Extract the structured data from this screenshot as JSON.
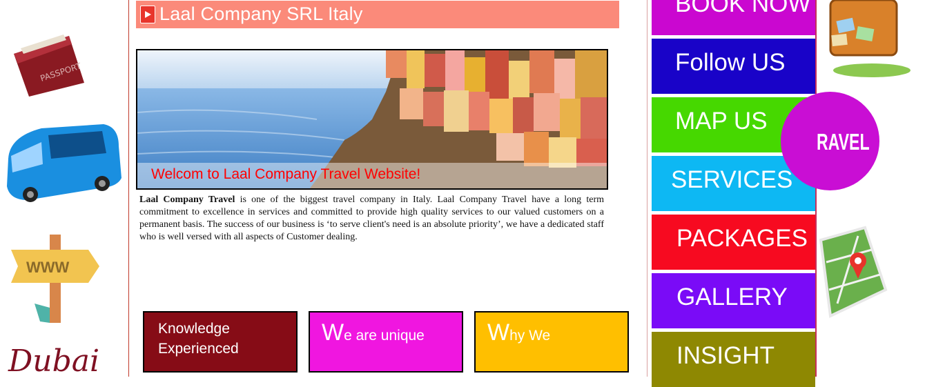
{
  "header": {
    "title": "Laal Company SRL Italy",
    "icon": "arrow-right-icon"
  },
  "hero": {
    "caption": "Welcom to  Laal Company Travel Website!"
  },
  "intro": {
    "company": "Laal Company Travel",
    "text": " is one of the biggest travel company in Italy. Laal Company Travel have a long term commitment to excellence in services and committed to provide high quality services to our valued customers on a permanent basis. The success of our business is ‘to serve client's need is an absolute priority’, we have a dedicated staff who is well versed with all aspects of Customer dealing."
  },
  "tiles": [
    {
      "line1": "Knowledge",
      "line2": "Experienced"
    },
    {
      "first": "W",
      "rest": "e  are unique"
    },
    {
      "first": "W",
      "rest": "hy We"
    }
  ],
  "nav": {
    "book": "BOOK NOW",
    "follow": "Follow US",
    "map": "MAP US",
    "services": "SERVICES",
    "packages": "PACKAGES",
    "gallery": "GALLERY",
    "insight": "INSIGHT"
  },
  "left_deco": {
    "dubai": "Dubai",
    "signpost": "WWW"
  },
  "right_deco": {
    "travel": "RAVEL"
  },
  "colors": {
    "title_bar": "#fb8a7a",
    "book": "#ca07d0",
    "follow": "#1903c8",
    "map": "#46d800",
    "services": "#0db8f3",
    "packages": "#f70a20",
    "gallery": "#7a0bf7",
    "insight": "#8e8802",
    "tile1": "#860c16",
    "tile2": "#f016e0",
    "tile3": "#ffbf00"
  }
}
